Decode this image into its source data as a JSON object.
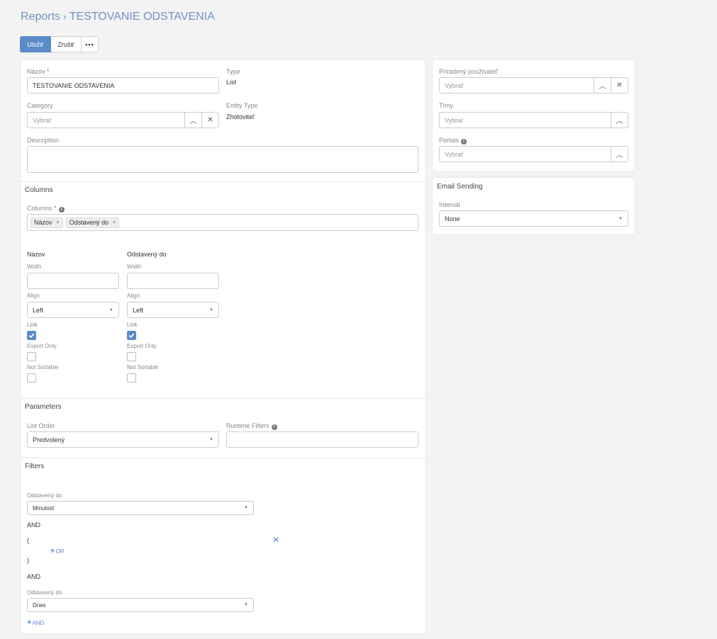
{
  "breadcrumb": {
    "root": "Reports",
    "separator": "›",
    "current": "TESTOVANIE ODSTAVENIA"
  },
  "toolbar": {
    "save_label": "Uložiť",
    "cancel_label": "Zrušiť",
    "more_label": "•••"
  },
  "main": {
    "name_label": "Názov *",
    "name_value": "TESTOVANIE ODSTAVENIA",
    "type_label": "Type",
    "type_value": "List",
    "category_label": "Category",
    "category_placeholder": "Vybrať",
    "entity_type_label": "Entity Type",
    "entity_type_value": "Zhotoviteľ",
    "description_label": "Description"
  },
  "columns_section": {
    "title": "Columns",
    "columns_label": "Columns *",
    "chips": [
      "Názov",
      "Odstavený do"
    ],
    "chip_remove": "×",
    "column_settings": [
      {
        "name": "Názov",
        "width_label": "Width",
        "align_label": "Align",
        "align_value": "Left",
        "link_label": "Link",
        "link_checked": true,
        "export_only_label": "Export Only",
        "not_sortable_label": "Not Sortable"
      },
      {
        "name": "Odstavený do",
        "width_label": "Width",
        "align_label": "Align",
        "align_value": "Left",
        "link_label": "Link",
        "link_checked": true,
        "export_only_label": "Export Only",
        "not_sortable_label": "Not Sortable"
      }
    ]
  },
  "parameters": {
    "title": "Parameters",
    "list_order_label": "List Order",
    "list_order_value": "Predvolený",
    "runtime_filters_label": "Runtime Filters"
  },
  "filters": {
    "title": "Filters",
    "filter1_label": "Odstavený do",
    "filter1_value": "Minulosť",
    "and1": "AND",
    "group_open": "(",
    "add_or": "OR",
    "group_close": ")",
    "and2": "AND",
    "filter2_label": "Odstavený do",
    "filter2_value": "Dnes",
    "add_and": "AND"
  },
  "side": {
    "assigned_user_label": "Priradený používateľ",
    "assigned_user_placeholder": "Vybrať",
    "teams_label": "Tímy",
    "teams_placeholder": "Vybrať",
    "portals_label": "Portals",
    "portals_placeholder": "Vybrať"
  },
  "email_sending": {
    "title": "Email Sending",
    "interval_label": "Interval",
    "interval_value": "None"
  },
  "icons": {
    "caret": "caret-down-icon",
    "up": "chevron-up-icon",
    "close": "close-icon",
    "info": "info-icon",
    "plus": "plus-icon"
  },
  "colors": {
    "accent": "#5b8cc9",
    "breadcrumb": "#6f93c6"
  }
}
